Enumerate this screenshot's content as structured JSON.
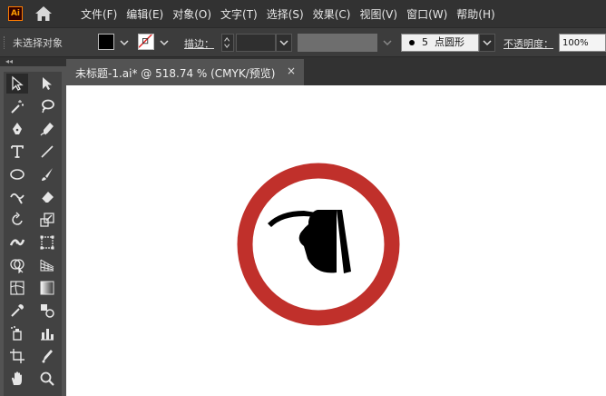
{
  "app": {
    "logo_text": "Ai",
    "accent": "#ff9a00"
  },
  "menu": {
    "items": [
      "文件(F)",
      "编辑(E)",
      "对象(O)",
      "文字(T)",
      "选择(S)",
      "效果(C)",
      "视图(V)",
      "窗口(W)",
      "帮助(H)"
    ]
  },
  "control_bar": {
    "selection_status": "未选择对象",
    "fill_color": "#000000",
    "stroke_label": "描边：",
    "brush_size": "5",
    "brush_shape": "点圆形",
    "opacity_label": "不透明度：",
    "opacity_value": "100%"
  },
  "document": {
    "tab_title": "未标题-1.ai* @ 518.74 % (CMYK/预览)",
    "close_glyph": "×"
  },
  "artwork": {
    "ring_color": "#c0302b",
    "fill_color": "#000000"
  },
  "tools": [
    "selection-tool",
    "direct-selection-tool",
    "magic-wand-tool",
    "lasso-tool",
    "pen-tool",
    "curvature-tool",
    "type-tool",
    "line-segment-tool",
    "ellipse-tool",
    "paintbrush-tool",
    "shaper-tool",
    "eraser-tool",
    "rotate-tool",
    "scale-tool",
    "width-tool",
    "free-transform-tool",
    "shape-builder-tool",
    "perspective-grid-tool",
    "mesh-tool",
    "gradient-tool",
    "eyedropper-tool",
    "blend-tool",
    "symbol-sprayer-tool",
    "column-graph-tool",
    "artboard-tool",
    "slice-tool",
    "hand-tool",
    "zoom-tool"
  ]
}
